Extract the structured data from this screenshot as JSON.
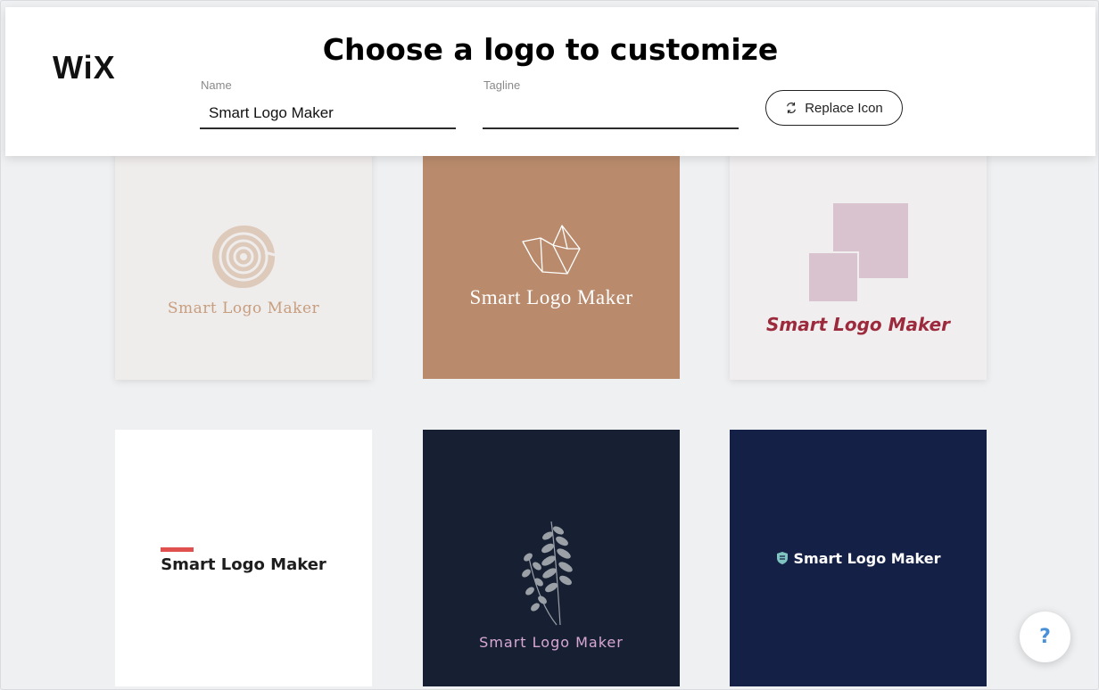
{
  "header": {
    "brand": "WiX",
    "title": "Choose a logo to customize",
    "name_label": "Name",
    "name_value": "Smart Logo Maker",
    "tagline_label": "Tagline",
    "tagline_value": "",
    "replace_icon_label": "Replace Icon"
  },
  "logos": [
    {
      "text": "Smart Logo Maker",
      "icon": "tree-rings-icon",
      "background": "#efecec"
    },
    {
      "text": "Smart Logo Maker",
      "icon": "geometric-shape-icon",
      "background": "#b98b6c"
    },
    {
      "text": "Smart Logo Maker",
      "icon": "overlapping-squares-icon",
      "background": "#f0eeee"
    },
    {
      "text": "Smart Logo Maker",
      "icon": "red-bar-accent",
      "background": "#ffffff"
    },
    {
      "text": "Smart Logo Maker",
      "icon": "leaf-branch-icon",
      "background": "#172033"
    },
    {
      "text": "Smart Logo Maker",
      "icon": "shield-icon",
      "background": "#152046"
    }
  ],
  "help": {
    "label": "?"
  }
}
